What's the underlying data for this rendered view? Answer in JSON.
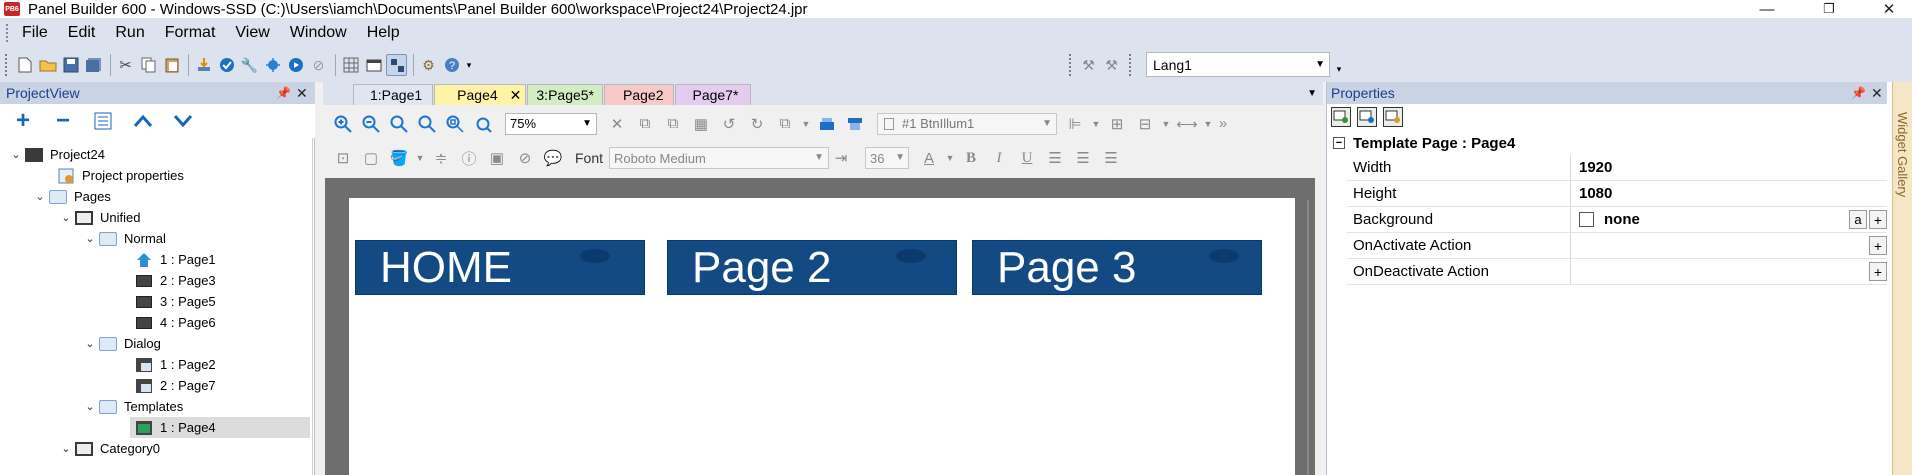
{
  "window": {
    "title": "Panel Builder 600 - Windows-SSD (C:)\\Users\\iamch\\Documents\\Panel Builder 600\\workspace\\Project24\\Project24.jpr",
    "logo_text": "PB6",
    "minimize": "—",
    "maximize": "❐",
    "close": "✕"
  },
  "menu": [
    "File",
    "Edit",
    "Run",
    "Format",
    "View",
    "Window",
    "Help"
  ],
  "toolbar": {
    "language_value": "Lang1"
  },
  "project_view": {
    "title": "ProjectView",
    "tools": {
      "add": "+",
      "remove": "−",
      "up": "⌃",
      "down": "⌄"
    },
    "tree": {
      "project": "Project24",
      "project_properties": "Project properties",
      "pages": "Pages",
      "unified": "Unified",
      "normal": "Normal",
      "normal_pages": [
        "1 : Page1",
        "2 : Page3",
        "3 : Page5",
        "4 : Page6"
      ],
      "dialog": "Dialog",
      "dialog_pages": [
        "1 : Page2",
        "2 : Page7"
      ],
      "templates": "Templates",
      "template_pages": [
        "1 : Page4"
      ],
      "category": "Category0"
    }
  },
  "editor": {
    "tabs": [
      {
        "label": "1:Page1",
        "color": "#dfe6f2"
      },
      {
        "label": "Page4",
        "color": "#fff3a8",
        "active": true
      },
      {
        "label": "3:Page5*",
        "color": "#d4ecc4"
      },
      {
        "label": "Page2",
        "color": "#f7c9c9"
      },
      {
        "label": "Page7*",
        "color": "#e3ccef"
      }
    ],
    "tab_close": "✕",
    "zoom_value": "75%",
    "object_select": "#1 BtnIllum1",
    "font_label": "Font",
    "font_value": "Roboto Medium",
    "font_size": "36",
    "format_buttons": {
      "bold": "B",
      "italic": "I",
      "underline": "U"
    },
    "canvas_buttons": [
      "HOME",
      "Page 2",
      "Page 3"
    ],
    "canvas_button_color": "#134a84"
  },
  "properties": {
    "title": "Properties",
    "group": "Template Page : Page4",
    "rows": [
      {
        "name": "Width",
        "value": "1920"
      },
      {
        "name": "Height",
        "value": "1080"
      },
      {
        "name": "Background",
        "value": "none"
      },
      {
        "name": "OnActivate Action",
        "value": ""
      },
      {
        "name": "OnDeactivate Action",
        "value": ""
      }
    ],
    "a_button": "a",
    "plus_button": "+"
  },
  "side_gallery": {
    "label": "Widget Gallery"
  }
}
